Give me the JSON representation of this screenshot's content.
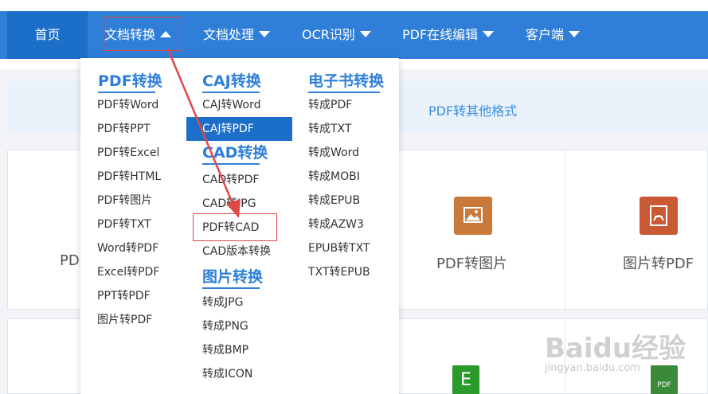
{
  "nav": {
    "items": [
      {
        "label": "首页"
      },
      {
        "label": "文档转换"
      },
      {
        "label": "文档处理"
      },
      {
        "label": "OCR识别"
      },
      {
        "label": "PDF在线编辑"
      },
      {
        "label": "客户端"
      }
    ]
  },
  "page": {
    "tab_label": "PDF转其他格式",
    "cards_row1": [
      {
        "label": "PD"
      },
      {
        "label": "PDF转图片",
        "icon": "image-icon",
        "color": "#c97a3a"
      },
      {
        "label": "图片转PDF",
        "icon": "pdf-icon",
        "color": "#c95a34"
      }
    ],
    "cards_row2_icons": [
      {
        "icon": "excel-icon",
        "letter": "E",
        "color": "#2a9a2a"
      },
      {
        "icon": "pdf-doc-icon",
        "letter": "PDF",
        "color": "#3a8a3a"
      }
    ]
  },
  "dropdown": {
    "columns": [
      {
        "heading": "PDF转换",
        "items": [
          "PDF转Word",
          "PDF转PPT",
          "PDF转Excel",
          "PDF转HTML",
          "PDF转图片",
          "PDF转TXT",
          "Word转PDF",
          "Excel转PDF",
          "PPT转PDF",
          "图片转PDF"
        ]
      },
      {
        "heading": "CAJ转换",
        "items": [
          "CAJ转Word",
          "CAJ转PDF"
        ]
      },
      {
        "heading": "CAD转换",
        "items": [
          "CAD转PDF",
          "CAD转JPG",
          "PDF转CAD",
          "CAD版本转换"
        ]
      },
      {
        "heading": "图片转换",
        "items": [
          "转成JPG",
          "转成PNG",
          "转成BMP",
          "转成ICON"
        ]
      },
      {
        "heading": "电子书转换",
        "items": [
          "转成PDF",
          "转成TXT",
          "转成Word",
          "转成MOBI",
          "转成EPUB",
          "转成AZW3",
          "EPUB转TXT",
          "TXT转EPUB"
        ]
      }
    ]
  },
  "annotation": {
    "color": "#e04848"
  },
  "watermark": {
    "brand": "Baidu经验",
    "url": "jingyan.baidu.com"
  }
}
